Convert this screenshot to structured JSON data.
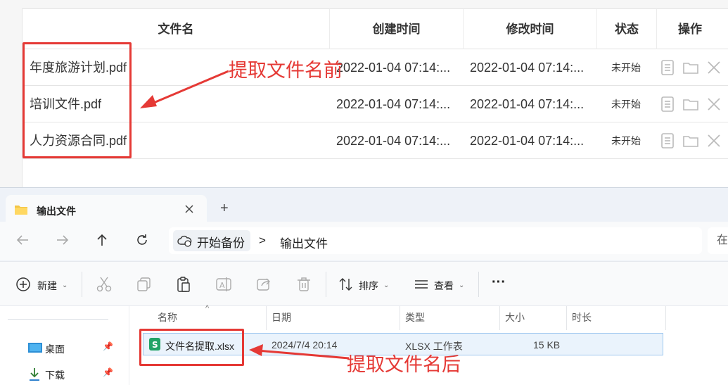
{
  "table": {
    "headers": {
      "filename": "文件名",
      "created": "创建时间",
      "modified": "修改时间",
      "status": "状态",
      "actions": "操作"
    },
    "rows": [
      {
        "name": "年度旅游计划.pdf",
        "created": "2022-01-04 07:14:...",
        "modified": "2022-01-04 07:14:...",
        "status": "未开始"
      },
      {
        "name": "培训文件.pdf",
        "created": "2022-01-04 07:14:...",
        "modified": "2022-01-04 07:14:...",
        "status": "未开始"
      },
      {
        "name": "人力资源合同.pdf",
        "created": "2022-01-04 07:14:...",
        "modified": "2022-01-04 07:14:...",
        "status": "未开始"
      }
    ]
  },
  "annotations": {
    "before": "提取文件名前",
    "after": "提取文件名后",
    "color": "#e53935"
  },
  "explorer": {
    "tab_title": "输出文件",
    "new_tab": "+",
    "breadcrumb": {
      "root": "开始备份",
      "separator": ">",
      "current": "输出文件"
    },
    "search_stub": "在",
    "toolbar": {
      "new": "新建",
      "sort": "排序",
      "view": "查看",
      "more": "···"
    },
    "columns": {
      "name": "名称",
      "date": "日期",
      "type": "类型",
      "size": "大小",
      "duration": "时长"
    },
    "sidebar": [
      {
        "label": "桌面",
        "icon": "desktop-icon"
      },
      {
        "label": "下载",
        "icon": "download-icon"
      }
    ],
    "file": {
      "name": "文件名提取.xlsx",
      "date": "2024/7/4 20:14",
      "type": "XLSX 工作表",
      "size": "15 KB",
      "icon": "excel-file-icon"
    }
  }
}
